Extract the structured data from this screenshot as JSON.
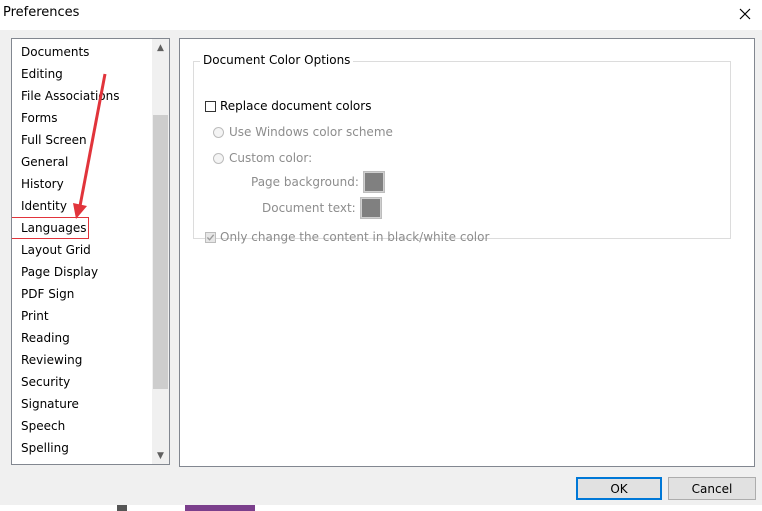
{
  "window": {
    "title": "Preferences"
  },
  "sidebar": {
    "items": [
      {
        "label": "Documents"
      },
      {
        "label": "Editing"
      },
      {
        "label": "File Associations"
      },
      {
        "label": "Forms"
      },
      {
        "label": "Full Screen"
      },
      {
        "label": "General"
      },
      {
        "label": "History"
      },
      {
        "label": "Identity"
      },
      {
        "label": "Languages",
        "selected": true
      },
      {
        "label": "Layout Grid"
      },
      {
        "label": "Page Display"
      },
      {
        "label": "PDF Sign"
      },
      {
        "label": "Print"
      },
      {
        "label": "Reading"
      },
      {
        "label": "Reviewing"
      },
      {
        "label": "Security"
      },
      {
        "label": "Signature"
      },
      {
        "label": "Speech"
      },
      {
        "label": "Spelling"
      }
    ]
  },
  "panel": {
    "group_title": "Document Color Options",
    "replace_colors": {
      "label": "Replace document colors",
      "checked": false
    },
    "use_windows_scheme": {
      "label": "Use Windows color scheme",
      "enabled": false
    },
    "custom_color": {
      "label": "Custom color:",
      "enabled": false
    },
    "page_background": {
      "label": "Page background:",
      "color": "#808080"
    },
    "document_text": {
      "label": "Document text:",
      "color": "#808080"
    },
    "only_black_white": {
      "label": "Only change the content in black/white color",
      "checked": true,
      "enabled": false
    }
  },
  "buttons": {
    "ok": "OK",
    "cancel": "Cancel"
  },
  "annotation": {
    "color": "#e1343b"
  }
}
